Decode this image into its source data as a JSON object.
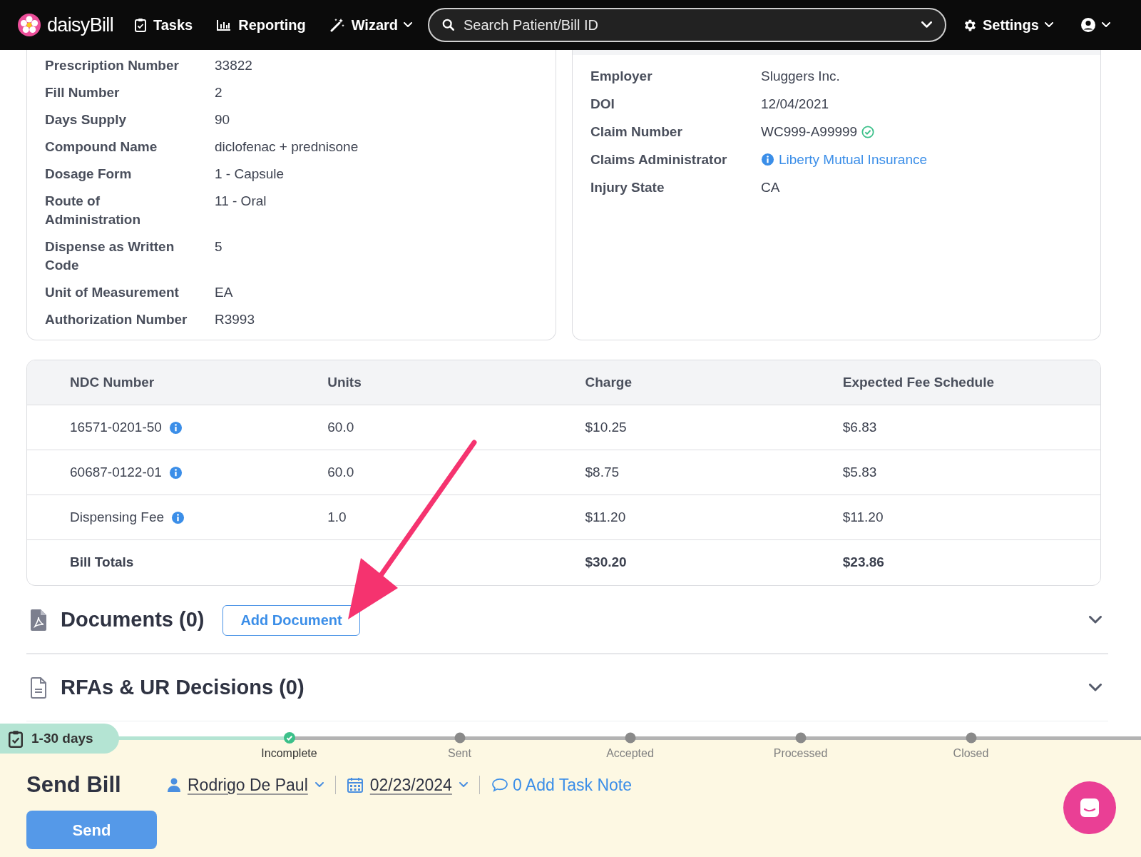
{
  "nav": {
    "brand": "daisyBill",
    "items": [
      {
        "label": "Tasks",
        "kind": "tasks"
      },
      {
        "label": "Reporting",
        "kind": "reporting"
      },
      {
        "label": "Wizard",
        "kind": "wizard"
      }
    ],
    "search": {
      "placeholder": "Search Patient/Bill ID"
    },
    "settings": "Settings"
  },
  "prescription": [
    {
      "label": "Prescription Number",
      "value": "33822"
    },
    {
      "label": "Fill Number",
      "value": "2"
    },
    {
      "label": "Days Supply",
      "value": "90"
    },
    {
      "label": "Compound Name",
      "value": "diclofenac + prednisone"
    },
    {
      "label": "Dosage Form",
      "value": "1 - Capsule"
    },
    {
      "label": "Route of Administration",
      "value": "11 - Oral"
    },
    {
      "label": "Dispense as Written Code",
      "value": "5"
    },
    {
      "label": "Unit of Measurement",
      "value": "EA"
    },
    {
      "label": "Authorization Number",
      "value": "R3993"
    }
  ],
  "claim": [
    {
      "label": "Employer",
      "value": "Sluggers Inc.",
      "kind": "text"
    },
    {
      "label": "DOI",
      "value": "12/04/2021",
      "kind": "text"
    },
    {
      "label": "Claim Number",
      "value": "WC999-A99999",
      "kind": "verified"
    },
    {
      "label": "Claims Administrator",
      "value": "Liberty Mutual Insurance",
      "kind": "link"
    },
    {
      "label": "Injury State",
      "value": "CA",
      "kind": "text"
    }
  ],
  "table": {
    "columns": [
      "NDC Number",
      "Units",
      "Charge",
      "Expected Fee Schedule"
    ],
    "rows": [
      {
        "cells": [
          "16571-0201-50",
          "60.0",
          "$10.25",
          "$6.83"
        ],
        "info": true,
        "total": false
      },
      {
        "cells": [
          "60687-0122-01",
          "60.0",
          "$8.75",
          "$5.83"
        ],
        "info": true,
        "total": false
      },
      {
        "cells": [
          "Dispensing Fee",
          "1.0",
          "$11.20",
          "$11.20"
        ],
        "info": true,
        "total": false
      },
      {
        "cells": [
          "Bill Totals",
          "",
          "$30.20",
          "$23.86"
        ],
        "info": false,
        "total": true
      }
    ]
  },
  "sections": [
    {
      "title": "Documents (0)",
      "kind": "pdf",
      "button": "Add Document"
    },
    {
      "title": "RFAs & UR Decisions (0)",
      "kind": "doc"
    }
  ],
  "timeline": {
    "badge": "1-30 days",
    "steps": [
      {
        "label": "Incomplete",
        "done": true
      },
      {
        "label": "Sent",
        "done": false
      },
      {
        "label": "Accepted",
        "done": false
      },
      {
        "label": "Processed",
        "done": false
      },
      {
        "label": "Closed",
        "done": false
      }
    ]
  },
  "task": {
    "title": "Send Bill",
    "assignee": "Rodrigo De Paul",
    "date": "02/23/2024",
    "note": "0 Add Task Note",
    "button": "Send"
  }
}
